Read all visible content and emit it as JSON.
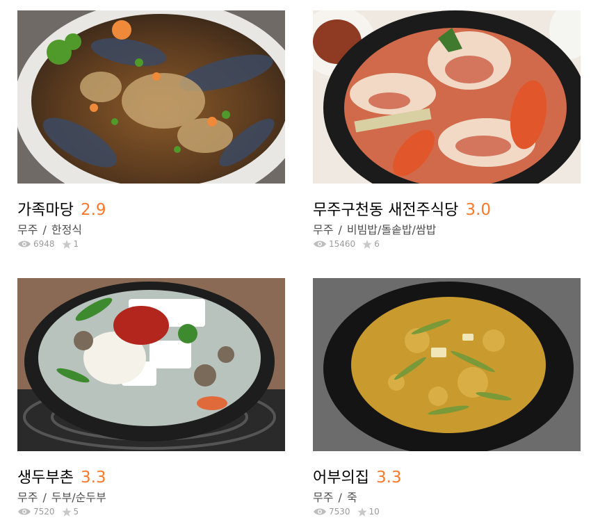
{
  "restaurants": [
    {
      "name": "가족마당",
      "score": "2.9",
      "region": "무주",
      "separator": "/",
      "category": "한정식",
      "views": "6948",
      "reviews": "1",
      "image": "crab-dish-photo"
    },
    {
      "name": "무주구천동 새전주식당",
      "score": "3.0",
      "region": "무주",
      "separator": "/",
      "category": "비빔밥/돌솥밥/쌈밥",
      "views": "15460",
      "reviews": "6",
      "image": "clam-stew-photo"
    },
    {
      "name": "생두부촌",
      "score": "3.3",
      "region": "무주",
      "separator": "/",
      "category": "두부/순두부",
      "views": "7520",
      "reviews": "5",
      "image": "tofu-hotpot-photo"
    },
    {
      "name": "어부의집",
      "score": "3.3",
      "region": "무주",
      "separator": "/",
      "category": "죽",
      "views": "7530",
      "reviews": "10",
      "image": "fish-porridge-photo"
    }
  ],
  "colors": {
    "score": "#ff792a",
    "meta": "#4f4f4f",
    "stats": "#9b9b9b"
  }
}
